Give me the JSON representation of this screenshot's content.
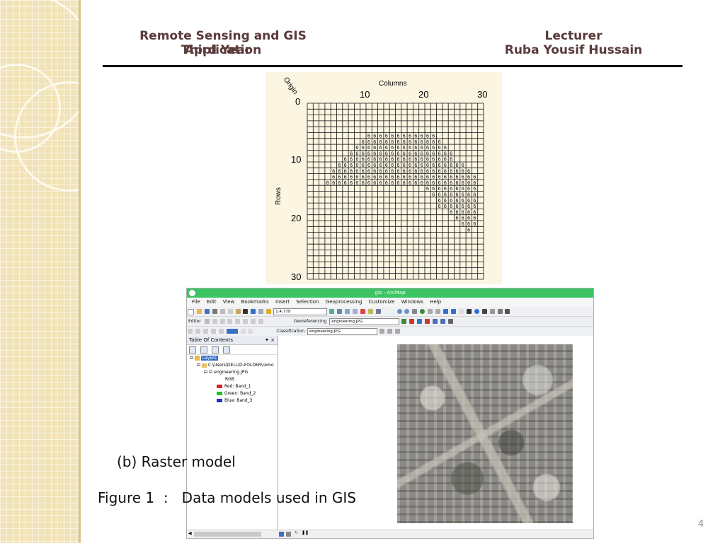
{
  "header": {
    "course_title": "Remote Sensing and GIS Application",
    "year": "Third Year",
    "lecturer_label": "Lecturer",
    "lecturer_name": "Ruba Yousif Hussain"
  },
  "raster_grid": {
    "origin_label": "Origin",
    "columns_label": "Columns",
    "rows_label": "Rows",
    "column_ticks": [
      "0",
      "10",
      "20",
      "30"
    ],
    "row_ticks": [
      "10",
      "20",
      "30"
    ],
    "cell_value": "6",
    "grid_cells": 30
  },
  "arcmap": {
    "window_title": "gis - ArcMap",
    "menu": [
      "File",
      "Edit",
      "View",
      "Bookmarks",
      "Insert",
      "Selection",
      "Geoprocessing",
      "Customize",
      "Windows",
      "Help"
    ],
    "scale_value": "1:4,779",
    "editor_label": "Editor",
    "georeferencing_label": "Georeferencing",
    "georef_layer": "engineering.JPG",
    "classification_label": "Classification",
    "class_layer": "engineering.JPG",
    "toc": {
      "title": "Table Of Contents",
      "pin": "✦ ×",
      "layers_label": "Layers",
      "folder_path": "C:\\Users\\DELL\\D-FOLDER\\remo",
      "raster_name": "engineering.JPG",
      "rgb_label": "RGB",
      "bands": [
        {
          "label": "Red:   Band_1",
          "color": "#e02020"
        },
        {
          "label": "Green: Band_2",
          "color": "#20c020"
        },
        {
          "label": "Blue:  Band_3",
          "color": "#2030d0"
        }
      ]
    }
  },
  "captions": {
    "sub_caption": "(b) Raster model",
    "figure_caption": "Figure 1  :   Data models used in GIS"
  },
  "page_number": "4"
}
